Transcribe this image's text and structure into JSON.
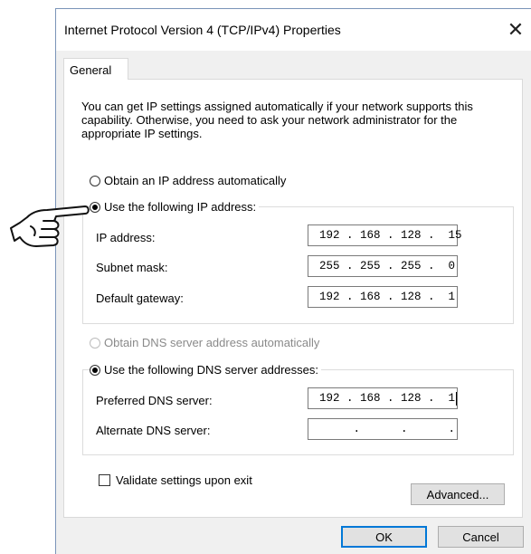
{
  "window": {
    "title": "Internet Protocol Version 4 (TCP/IPv4) Properties",
    "close_glyph": "✕"
  },
  "tabs": [
    {
      "label": "General",
      "active": true
    }
  ],
  "description": "You can get IP settings assigned automatically if your network supports this capability. Otherwise, you need to ask your network administrator for the appropriate IP settings.",
  "ip_mode": {
    "auto_label": "Obtain an IP address automatically",
    "manual_label": "Use the following IP address:",
    "selected": "manual"
  },
  "ip_fields": {
    "ip_address": {
      "label": "IP address:",
      "value": "192 . 168 . 128 .  15"
    },
    "subnet_mask": {
      "label": "Subnet mask:",
      "value": "255 . 255 . 255 .  0"
    },
    "default_gateway": {
      "label": "Default gateway:",
      "value": "192 . 168 . 128 .  1"
    }
  },
  "dns_mode": {
    "auto_label": "Obtain DNS server address automatically",
    "manual_label": "Use the following DNS server addresses:",
    "selected": "manual",
    "auto_disabled": true
  },
  "dns_fields": {
    "preferred": {
      "label": "Preferred DNS server:",
      "value": "192 . 168 . 128 .  1"
    },
    "alternate": {
      "label": "Alternate DNS server:",
      "value": "     .      .      ."
    }
  },
  "validate": {
    "label": "Validate settings upon exit",
    "checked": false
  },
  "buttons": {
    "advanced": "Advanced...",
    "ok": "OK",
    "cancel": "Cancel"
  },
  "colors": {
    "accent": "#0078d7",
    "dialog_bg": "#f0f0f0",
    "panel_bg": "#ffffff"
  },
  "annotation_icon": "pointing-hand-icon"
}
